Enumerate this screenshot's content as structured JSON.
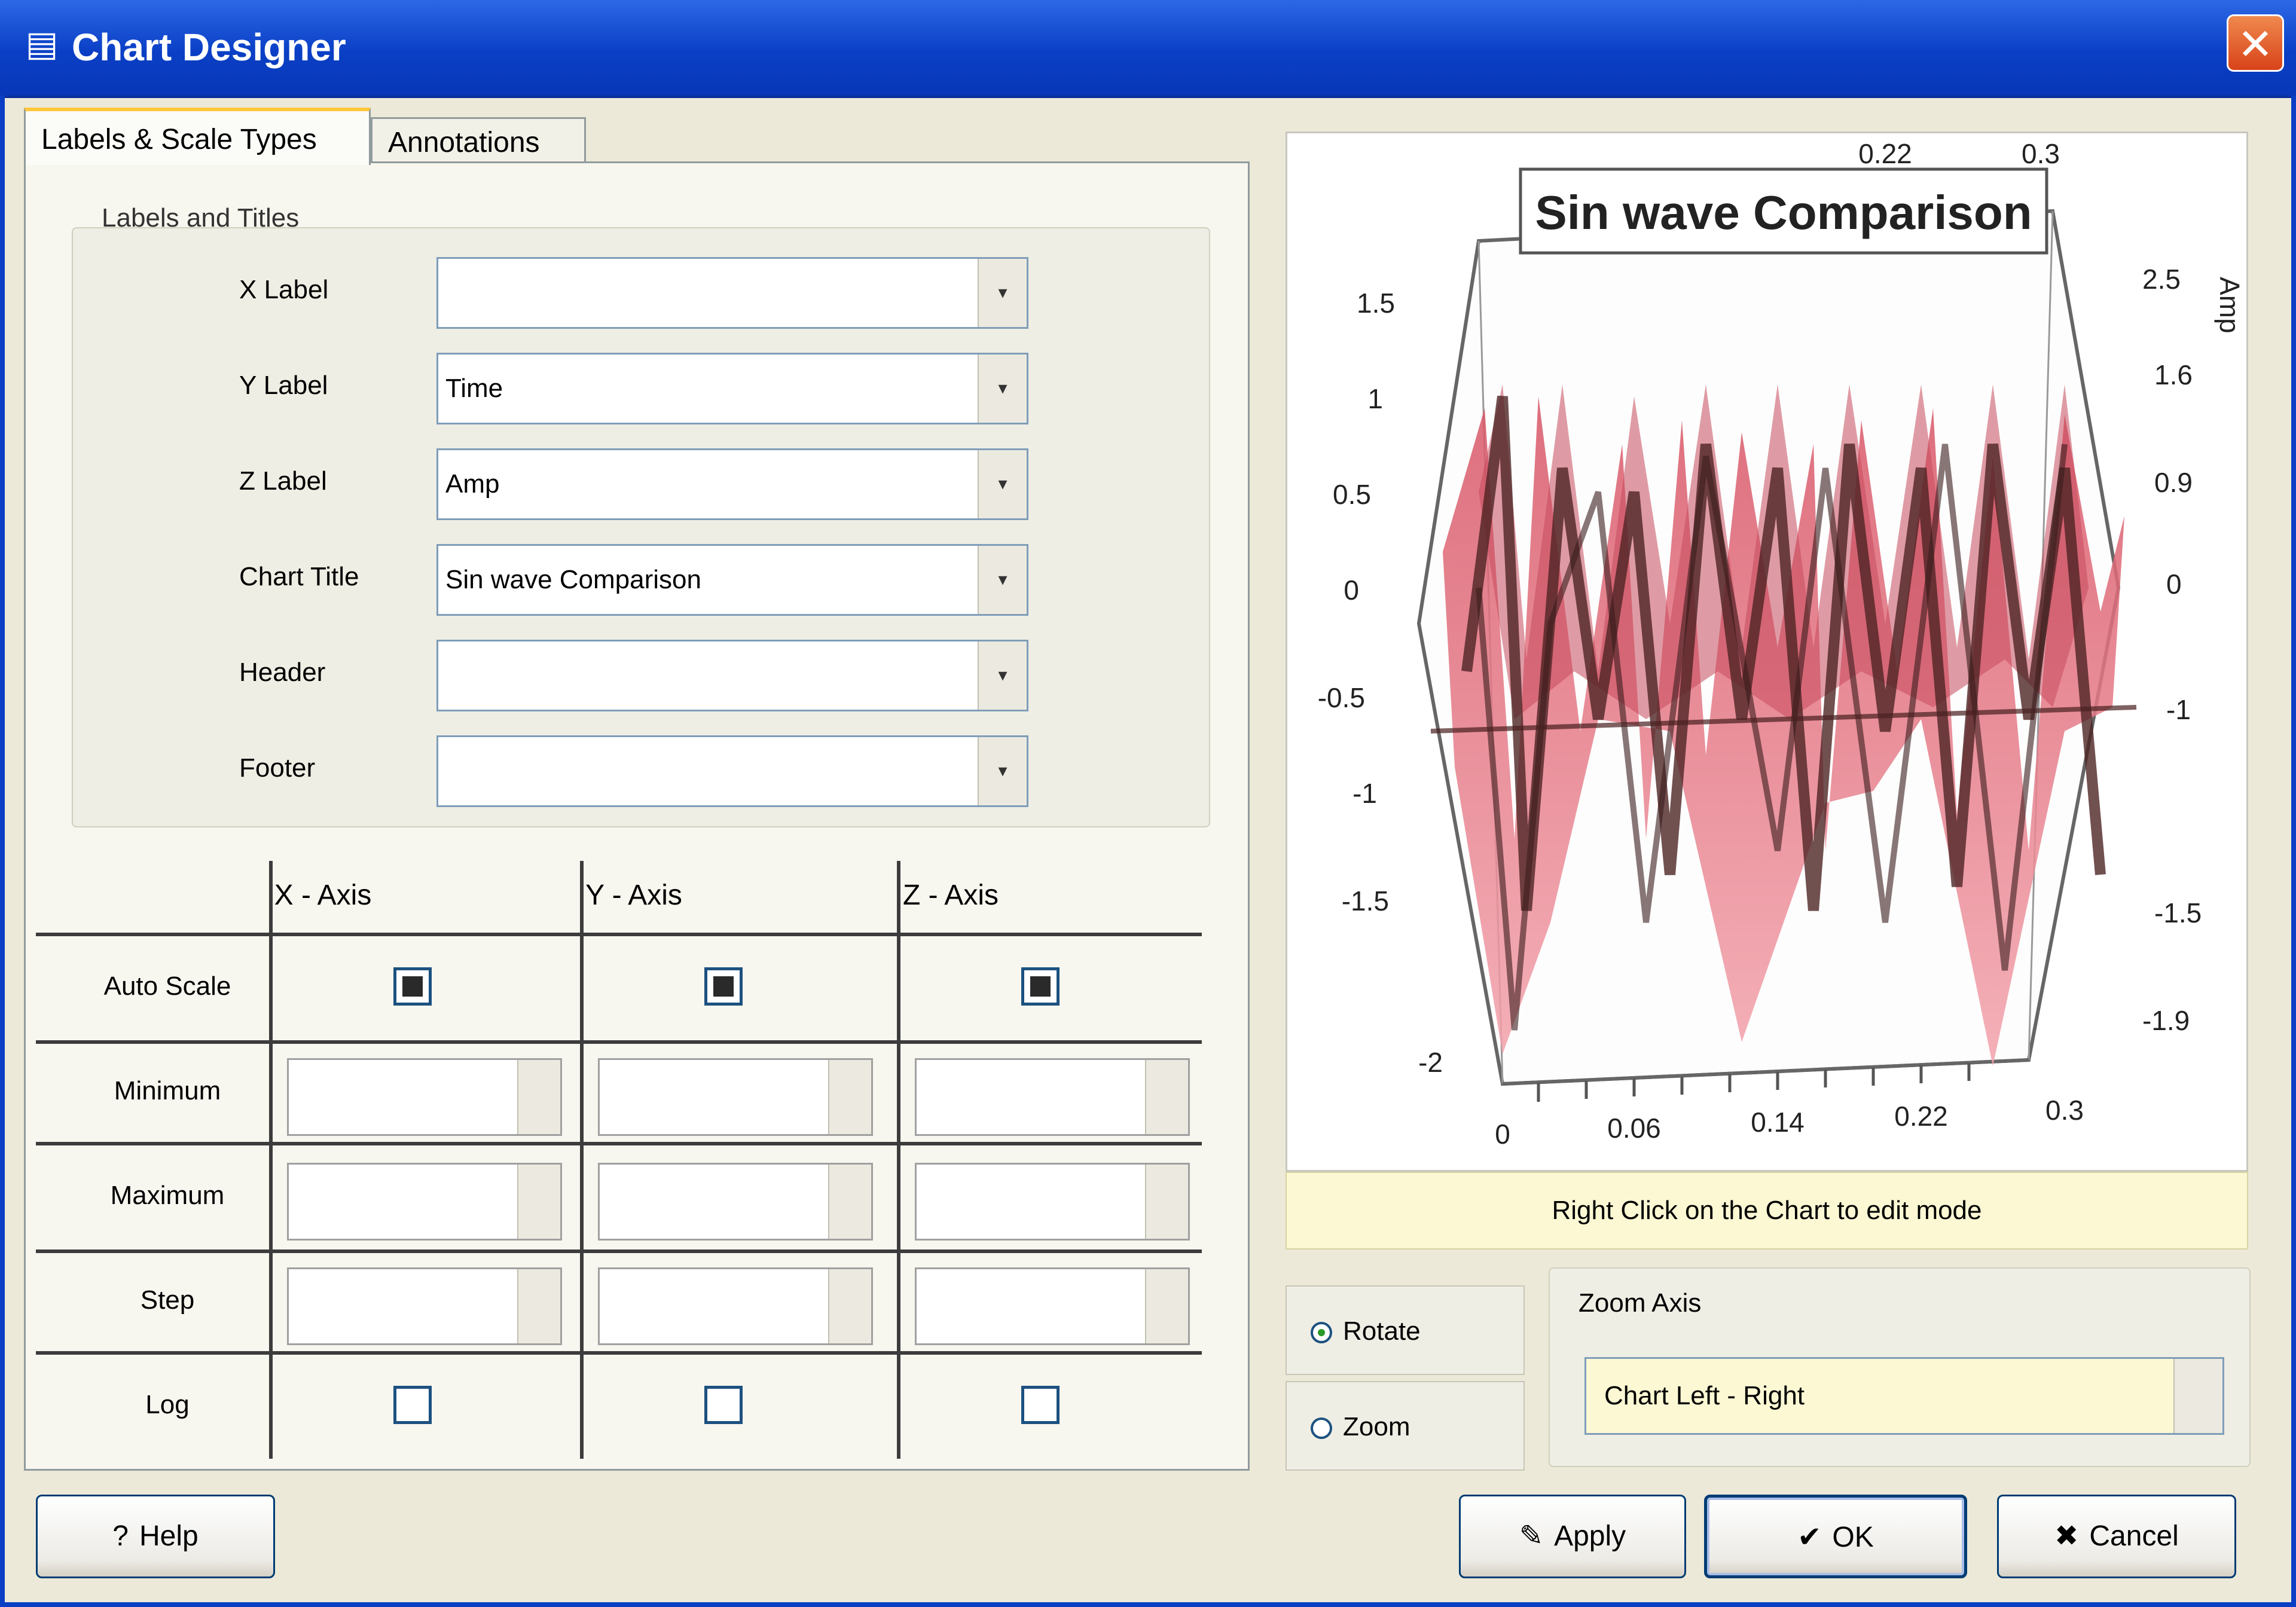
{
  "window": {
    "title": "Chart Designer",
    "close_glyph": "✕",
    "app_icon": "chart-icon"
  },
  "tabs": [
    {
      "label": "Labels & Scale Types"
    },
    {
      "label": "Annotations"
    }
  ],
  "labels_group": {
    "title": "Labels and Titles",
    "fields": [
      {
        "label": "X Label",
        "value": ""
      },
      {
        "label": "Y Label",
        "value": "Time"
      },
      {
        "label": "Z Label",
        "value": "Amp"
      },
      {
        "label": "Chart Title",
        "value": "Sin wave Comparison"
      },
      {
        "label": "Header",
        "value": ""
      },
      {
        "label": "Footer",
        "value": ""
      }
    ]
  },
  "axis_grid": {
    "columns": [
      "X - Axis",
      "Y - Axis",
      "Z - Axis"
    ],
    "rows": [
      "Auto Scale",
      "Minimum",
      "Maximum",
      "Step",
      "Log"
    ],
    "auto_scale": [
      true,
      true,
      true
    ],
    "log": [
      false,
      false,
      false
    ]
  },
  "preview": {
    "title": "Sin wave Comparison",
    "y_ticks": [
      "1.5",
      "1",
      "0.5",
      "0",
      "-0.5",
      "-1",
      "-1.5",
      "-2"
    ],
    "right_ticks": [
      "2.5",
      "1.6",
      "0.9",
      "0",
      "-1",
      "-1.5",
      "-1.9"
    ],
    "x_ticks": [
      "0",
      "0.06",
      "0.14",
      "0.22",
      "0.3"
    ],
    "top_ticks": [
      "0.22",
      "0.3"
    ],
    "side_label": "Amp",
    "colors": {
      "pink": "#e9717d",
      "dark": "#5a2a2a"
    }
  },
  "hint": "Right Click on the Chart to edit mode",
  "mode": {
    "options": [
      "Rotate",
      "Zoom"
    ],
    "selected": 0
  },
  "zoom": {
    "label": "Zoom Axis",
    "value": "Chart Left - Right"
  },
  "buttons": {
    "help": "Help",
    "apply": "Apply",
    "ok": "OK",
    "cancel": "Cancel"
  }
}
